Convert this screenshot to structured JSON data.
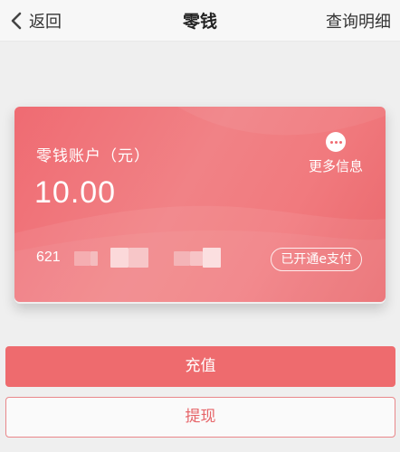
{
  "header": {
    "back_label": "返回",
    "title": "零钱",
    "detail_label": "查询明细"
  },
  "card": {
    "account_label": "零钱账户（元）",
    "balance": "10.00",
    "more_label": "更多信息",
    "card_number_prefix": "621",
    "epay_label": "已开通e支付",
    "colors": {
      "card_gradient_start": "#ef6b72",
      "card_gradient_end": "#e9676c"
    }
  },
  "actions": {
    "recharge_label": "充值",
    "withdraw_label": "提现"
  },
  "icons": {
    "back": "chevron-left-icon",
    "more": "more-dots-icon"
  },
  "colors": {
    "accent": "#ee6b6e",
    "background": "#efefef"
  }
}
